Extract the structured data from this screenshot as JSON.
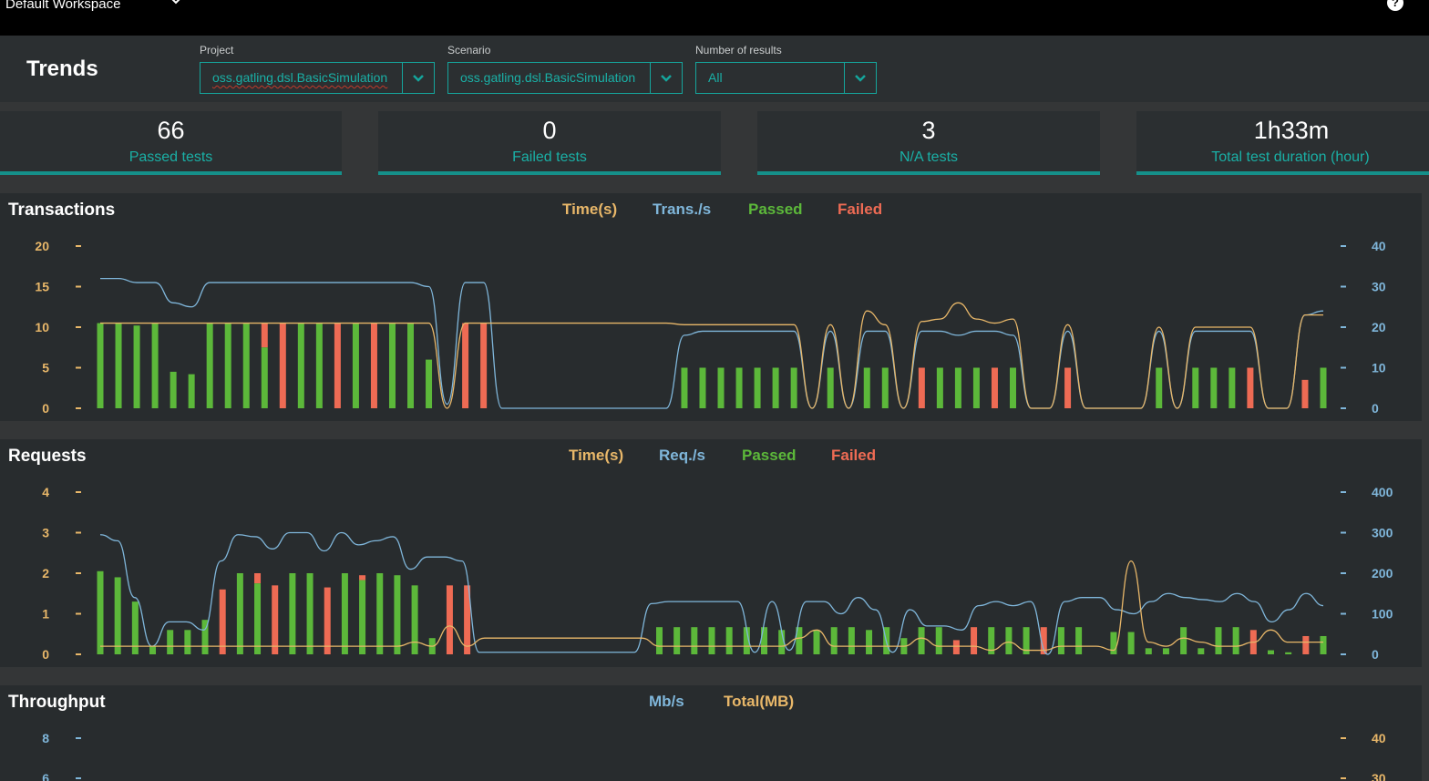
{
  "topbar": {
    "workspace": "Default Workspace",
    "help_icon": "question-icon"
  },
  "page_title": "Trends",
  "filters": {
    "project": {
      "label": "Project",
      "value": "oss.gatling.dsl.BasicSimulation"
    },
    "scenario": {
      "label": "Scenario",
      "value": "oss.gatling.dsl.BasicSimulation"
    },
    "results": {
      "label": "Number of results",
      "value": "All"
    }
  },
  "stats": [
    {
      "value": "66",
      "label": "Passed tests"
    },
    {
      "value": "0",
      "label": "Failed tests"
    },
    {
      "value": "3",
      "label": "N/A tests"
    },
    {
      "value": "1h33m",
      "label": "Total test duration (hour)"
    }
  ],
  "colors": {
    "accent": "#15a59c",
    "time": "#e8b769",
    "rate": "#7fb6da",
    "passed": "#5cb83a",
    "failed": "#ee6b54"
  },
  "chart_data": [
    {
      "type": "bar",
      "title": "Transactions",
      "legend": [
        "Time(s)",
        "Trans./s",
        "Passed",
        "Failed"
      ],
      "yleft": {
        "ticks": [
          "20",
          "15",
          "10",
          "5",
          "0"
        ],
        "range": [
          0,
          20
        ]
      },
      "yright": {
        "ticks": [
          "40",
          "30",
          "20",
          "10",
          "0"
        ],
        "range": [
          0,
          40
        ]
      },
      "bars": [
        {
          "v": 10.5,
          "s": "p"
        },
        {
          "v": 10.5,
          "s": "p"
        },
        {
          "v": 10.2,
          "s": "p"
        },
        {
          "v": 10.5,
          "s": "p"
        },
        {
          "v": 4.5,
          "s": "p"
        },
        {
          "v": 4.2,
          "s": "p"
        },
        {
          "v": 10.5,
          "s": "p"
        },
        {
          "v": 10.5,
          "s": "p"
        },
        {
          "v": 10.5,
          "s": "p"
        },
        {
          "v": 10.5,
          "s": "m",
          "f": 3
        },
        {
          "v": 10.5,
          "s": "f"
        },
        {
          "v": 10.5,
          "s": "p"
        },
        {
          "v": 10.5,
          "s": "p"
        },
        {
          "v": 10.5,
          "s": "f"
        },
        {
          "v": 10.5,
          "s": "p"
        },
        {
          "v": 10.5,
          "s": "f"
        },
        {
          "v": 10.5,
          "s": "p"
        },
        {
          "v": 10.5,
          "s": "p"
        },
        {
          "v": 6,
          "s": "p"
        },
        {
          "v": 0,
          "s": "n"
        },
        {
          "v": 10.5,
          "s": "f"
        },
        {
          "v": 10.5,
          "s": "f"
        },
        {
          "v": 0,
          "s": "n"
        },
        {
          "v": 0,
          "s": "n"
        },
        {
          "v": 0,
          "s": "n"
        },
        {
          "v": 0,
          "s": "n"
        },
        {
          "v": 0,
          "s": "n"
        },
        {
          "v": 0,
          "s": "n"
        },
        {
          "v": 0,
          "s": "n"
        },
        {
          "v": 0,
          "s": "n"
        },
        {
          "v": 0,
          "s": "n"
        },
        {
          "v": 0,
          "s": "n"
        },
        {
          "v": 5,
          "s": "p"
        },
        {
          "v": 5,
          "s": "p"
        },
        {
          "v": 5,
          "s": "p"
        },
        {
          "v": 5,
          "s": "p"
        },
        {
          "v": 5,
          "s": "p"
        },
        {
          "v": 5,
          "s": "p"
        },
        {
          "v": 5,
          "s": "p"
        },
        {
          "v": 0,
          "s": "n"
        },
        {
          "v": 5,
          "s": "p"
        },
        {
          "v": 0,
          "s": "n"
        },
        {
          "v": 5,
          "s": "p"
        },
        {
          "v": 5,
          "s": "p"
        },
        {
          "v": 0,
          "s": "n"
        },
        {
          "v": 5,
          "s": "f"
        },
        {
          "v": 5,
          "s": "p"
        },
        {
          "v": 5,
          "s": "p"
        },
        {
          "v": 5,
          "s": "p"
        },
        {
          "v": 5,
          "s": "f"
        },
        {
          "v": 5,
          "s": "p"
        },
        {
          "v": 0,
          "s": "n"
        },
        {
          "v": 0,
          "s": "n"
        },
        {
          "v": 5,
          "s": "f"
        },
        {
          "v": 0,
          "s": "n"
        },
        {
          "v": 0,
          "s": "n"
        },
        {
          "v": 0,
          "s": "n"
        },
        {
          "v": 0,
          "s": "n"
        },
        {
          "v": 5,
          "s": "p"
        },
        {
          "v": 0,
          "s": "n"
        },
        {
          "v": 5,
          "s": "p"
        },
        {
          "v": 5,
          "s": "p"
        },
        {
          "v": 5,
          "s": "p"
        },
        {
          "v": 5,
          "s": "f"
        },
        {
          "v": 0,
          "s": "n"
        },
        {
          "v": 0,
          "s": "n"
        },
        {
          "v": 3.5,
          "s": "f"
        },
        {
          "v": 5,
          "s": "p"
        }
      ],
      "rate_line": [
        32,
        32,
        31,
        31,
        26,
        25,
        31,
        31,
        31,
        31,
        31,
        31,
        31,
        31,
        31,
        31,
        31,
        31,
        30,
        1,
        31,
        31,
        0,
        0,
        0,
        0,
        0,
        0,
        0,
        0,
        0,
        0,
        18,
        19,
        19,
        19,
        19,
        19,
        19,
        0,
        19,
        0,
        19,
        19,
        0,
        19,
        19,
        18,
        19,
        19,
        18,
        0,
        0,
        19,
        0,
        0,
        0,
        0,
        19,
        0,
        19,
        19,
        19,
        19,
        0,
        0,
        23,
        24
      ],
      "time_line": [
        10.5,
        10.5,
        10.5,
        10.5,
        10.5,
        10.5,
        10.5,
        10.5,
        10.5,
        10.5,
        10.5,
        10.5,
        10.5,
        10.5,
        10.5,
        10.5,
        10.5,
        10.5,
        10.5,
        0,
        10.5,
        10.5,
        10.5,
        10.5,
        10.5,
        10.5,
        10.5,
        10.5,
        10.5,
        10.5,
        10.5,
        10.5,
        10.3,
        10.3,
        10.3,
        10.3,
        10.3,
        10.3,
        10.3,
        0,
        10.3,
        0,
        12,
        10.3,
        0,
        10.7,
        11,
        13,
        11,
        10.5,
        11,
        0,
        0,
        10.3,
        0,
        0,
        0,
        0,
        10,
        0,
        10,
        10,
        10,
        10,
        0,
        0,
        11.5,
        11.5
      ]
    },
    {
      "type": "bar",
      "title": "Requests",
      "legend": [
        "Time(s)",
        "Req./s",
        "Passed",
        "Failed"
      ],
      "yleft": {
        "ticks": [
          "4",
          "3",
          "2",
          "1",
          "0"
        ],
        "range": [
          0,
          4
        ]
      },
      "yright": {
        "ticks": [
          "400",
          "300",
          "200",
          "100",
          "0"
        ],
        "range": [
          0,
          400
        ]
      },
      "bars": [
        {
          "v": 2.05,
          "s": "p"
        },
        {
          "v": 1.9,
          "s": "p"
        },
        {
          "v": 1.3,
          "s": "p"
        },
        {
          "v": 0.2,
          "s": "p"
        },
        {
          "v": 0.6,
          "s": "p"
        },
        {
          "v": 0.6,
          "s": "p"
        },
        {
          "v": 0.85,
          "s": "p"
        },
        {
          "v": 1.6,
          "s": "f"
        },
        {
          "v": 2.0,
          "s": "p"
        },
        {
          "v": 2.0,
          "s": "m",
          "f": 0.25
        },
        {
          "v": 1.7,
          "s": "f"
        },
        {
          "v": 2.0,
          "s": "p"
        },
        {
          "v": 2.0,
          "s": "p"
        },
        {
          "v": 1.65,
          "s": "f"
        },
        {
          "v": 2.0,
          "s": "p"
        },
        {
          "v": 1.95,
          "s": "m",
          "f": 0.12
        },
        {
          "v": 2.0,
          "s": "p"
        },
        {
          "v": 1.95,
          "s": "p"
        },
        {
          "v": 1.7,
          "s": "p"
        },
        {
          "v": 0.4,
          "s": "p"
        },
        {
          "v": 1.7,
          "s": "f"
        },
        {
          "v": 1.7,
          "s": "f"
        },
        {
          "v": 0,
          "s": "n"
        },
        {
          "v": 0,
          "s": "n"
        },
        {
          "v": 0,
          "s": "n"
        },
        {
          "v": 0,
          "s": "n"
        },
        {
          "v": 0,
          "s": "n"
        },
        {
          "v": 0,
          "s": "n"
        },
        {
          "v": 0,
          "s": "n"
        },
        {
          "v": 0,
          "s": "n"
        },
        {
          "v": 0,
          "s": "n"
        },
        {
          "v": 0,
          "s": "n"
        },
        {
          "v": 0.67,
          "s": "p"
        },
        {
          "v": 0.67,
          "s": "p"
        },
        {
          "v": 0.67,
          "s": "p"
        },
        {
          "v": 0.67,
          "s": "p"
        },
        {
          "v": 0.67,
          "s": "p"
        },
        {
          "v": 0.67,
          "s": "p"
        },
        {
          "v": 0.67,
          "s": "p"
        },
        {
          "v": 0.6,
          "s": "p"
        },
        {
          "v": 0.67,
          "s": "p"
        },
        {
          "v": 0.6,
          "s": "p"
        },
        {
          "v": 0.67,
          "s": "p"
        },
        {
          "v": 0.67,
          "s": "p"
        },
        {
          "v": 0.6,
          "s": "p"
        },
        {
          "v": 0.67,
          "s": "p"
        },
        {
          "v": 0.4,
          "s": "p"
        },
        {
          "v": 0.67,
          "s": "p"
        },
        {
          "v": 0.67,
          "s": "p"
        },
        {
          "v": 0.35,
          "s": "f"
        },
        {
          "v": 0.67,
          "s": "f"
        },
        {
          "v": 0.67,
          "s": "p"
        },
        {
          "v": 0.67,
          "s": "p"
        },
        {
          "v": 0.67,
          "s": "p"
        },
        {
          "v": 0.67,
          "s": "f"
        },
        {
          "v": 0.67,
          "s": "p"
        },
        {
          "v": 0.67,
          "s": "p"
        },
        {
          "v": 0.05,
          "s": "n"
        },
        {
          "v": 0.55,
          "s": "p"
        },
        {
          "v": 0.55,
          "s": "p"
        },
        {
          "v": 0.15,
          "s": "p"
        },
        {
          "v": 0.15,
          "s": "p"
        },
        {
          "v": 0.67,
          "s": "p"
        },
        {
          "v": 0.15,
          "s": "p"
        },
        {
          "v": 0.67,
          "s": "p"
        },
        {
          "v": 0.67,
          "s": "p"
        },
        {
          "v": 0.6,
          "s": "f"
        },
        {
          "v": 0.1,
          "s": "p"
        },
        {
          "v": 0.05,
          "s": "p"
        },
        {
          "v": 0.45,
          "s": "f"
        },
        {
          "v": 0.45,
          "s": "p"
        }
      ],
      "rate_line": [
        295,
        280,
        140,
        20,
        80,
        80,
        60,
        230,
        295,
        290,
        260,
        300,
        300,
        255,
        300,
        270,
        280,
        290,
        210,
        240,
        240,
        230,
        5,
        5,
        5,
        5,
        5,
        5,
        5,
        5,
        5,
        5,
        125,
        130,
        130,
        130,
        130,
        130,
        5,
        130,
        10,
        130,
        130,
        100,
        140,
        110,
        5,
        110,
        70,
        70,
        60,
        120,
        130,
        120,
        130,
        0,
        130,
        140,
        140,
        110,
        100,
        130,
        150,
        140,
        135,
        130,
        150,
        130,
        80,
        110,
        150,
        120
      ],
      "time_line": [
        0.2,
        0.2,
        0.2,
        0.2,
        0.2,
        0.2,
        0.2,
        0.2,
        0.2,
        0.2,
        0.2,
        0.2,
        0.2,
        0.2,
        0.2,
        0.2,
        0.2,
        0.2,
        0.3,
        0.2,
        0.7,
        0.2,
        0.4,
        0.4,
        0.4,
        0.4,
        0.4,
        0.4,
        0.4,
        0.4,
        0.4,
        0.4,
        0.2,
        0.2,
        0.2,
        0.2,
        0.2,
        0.2,
        0.2,
        0.2,
        0.4,
        0.6,
        0.2,
        0.2,
        0.2,
        0.2,
        0.2,
        0.4,
        0.2,
        0.2,
        0.2,
        0.1,
        0.3,
        0.1,
        0.1,
        0.2,
        0.2,
        0.2,
        0.1,
        2.3,
        0.3,
        0.2,
        0.4,
        0.3,
        0.2,
        0.2,
        0.3,
        0.6,
        0.3,
        0.3,
        0.3
      ]
    },
    {
      "type": "line",
      "title": "Throughput",
      "legend": [
        "Mb/s",
        "Total(MB)"
      ],
      "yleft": {
        "ticks": [
          "8",
          "6"
        ],
        "range": [
          0,
          8
        ]
      },
      "yright": {
        "ticks": [
          "40",
          "30"
        ],
        "range": [
          0,
          40
        ]
      }
    }
  ]
}
